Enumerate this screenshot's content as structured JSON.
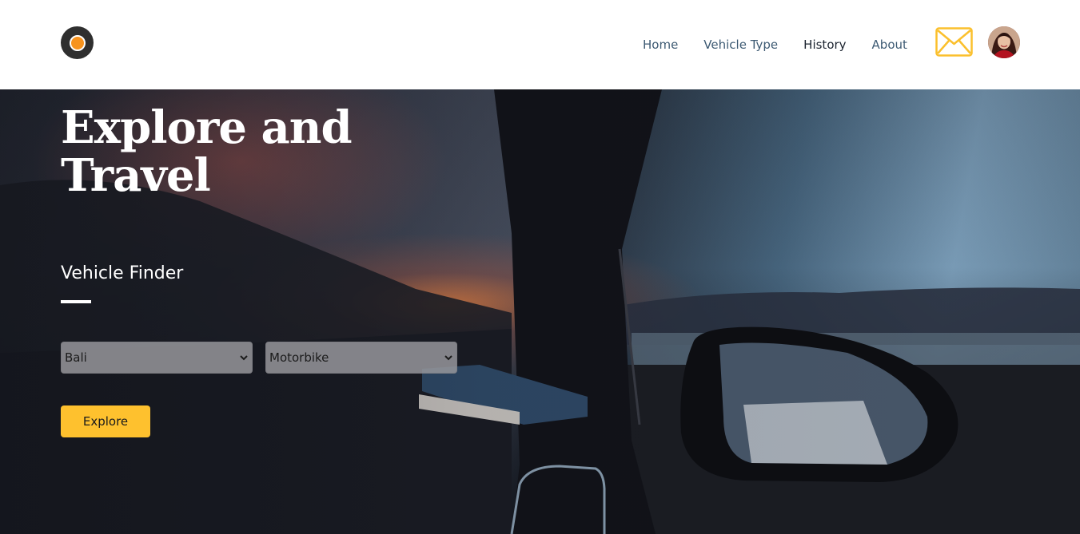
{
  "nav": {
    "items": [
      {
        "label": "Home",
        "active": false
      },
      {
        "label": "Vehicle Type",
        "active": false
      },
      {
        "label": "History",
        "active": true
      },
      {
        "label": "About",
        "active": false
      }
    ]
  },
  "header": {
    "logo_icon": "circle-logo-icon",
    "mail_icon": "envelope-icon",
    "accent_color": "#f7931e"
  },
  "hero": {
    "title": "Explore and Travel",
    "finder_title": "Vehicle Finder",
    "location_select": {
      "value": "Bali"
    },
    "vehicle_select": {
      "value": "Motorbike"
    },
    "explore_label": "Explore",
    "button_color": "#fec12e"
  }
}
